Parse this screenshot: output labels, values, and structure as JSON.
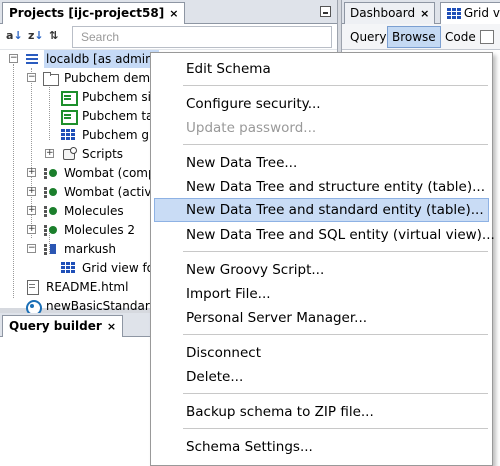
{
  "projects_panel": {
    "tab_label": "Projects [ijc-project58]",
    "search_placeholder": "Search",
    "tree": {
      "root": "localdb [as admin]",
      "folder": "Pubchem demo",
      "items": [
        "Pubchem sir",
        "Pubchem ta",
        "Pubchem gr",
        "Scripts",
        "Wombat (comp",
        "Wombat (activi",
        "Molecules",
        "Molecules 2",
        "markush",
        "Grid view fo",
        "README.html",
        "newBasicStandard"
      ]
    }
  },
  "query_builder": {
    "tab_label": "Query builder"
  },
  "right_panel": {
    "tabs": [
      "Dashboard",
      "Grid vie"
    ],
    "buttons": [
      "Query",
      "Browse",
      "Code"
    ],
    "active_button": "Browse"
  },
  "context_menu": {
    "items": [
      "Edit Schema",
      "Configure security...",
      "Update password...",
      "New Data Tree...",
      "New Data Tree and structure entity (table)...",
      "New Data Tree and standard entity (table)...",
      "New Data Tree and SQL entity (virtual view)...",
      "New Groovy Script...",
      "Import File...",
      "Personal Server Manager...",
      "Disconnect",
      "Delete...",
      "Backup schema to ZIP file...",
      "Schema Settings..."
    ],
    "highlighted": "New Data Tree and standard entity (table)...",
    "disabled": [
      "Update password..."
    ]
  },
  "colors": {
    "selection": "#c6daf6",
    "menu_highlight": "#c9dcf5",
    "active_button": "#c4d9f3"
  }
}
